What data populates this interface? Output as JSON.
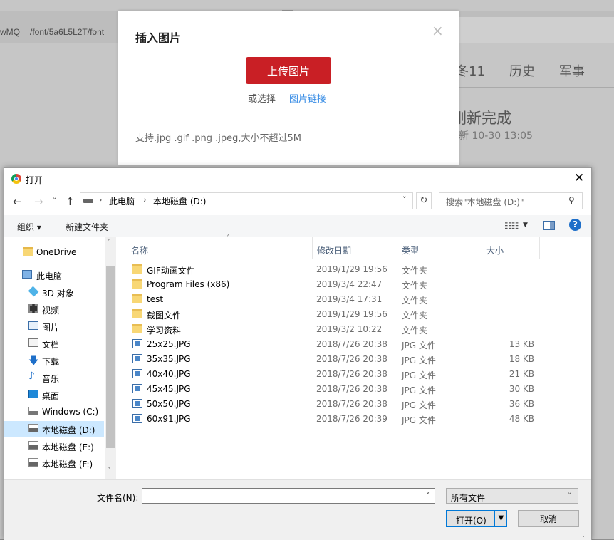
{
  "background": {
    "url_fragment": "wMQ==/font/5a6L5L2T/font",
    "tabs": [
      "冬11",
      "历史",
      "军事"
    ],
    "headline": "刚新完成",
    "meta": "新 10-30 13:05"
  },
  "modal": {
    "title": "插入图片",
    "close": "×",
    "upload_label": "上传图片",
    "or_choose": "或选择",
    "image_link": "图片链接",
    "support_text": "支持.jpg .gif .png .jpeg,大小不超过5M",
    "accent_color": "#c91f25"
  },
  "dialog": {
    "title": "打开",
    "close": "✕",
    "nav": {
      "back": "←",
      "forward": "→",
      "recent": "˅",
      "up": "↑"
    },
    "address": {
      "crumbs": [
        "此电脑",
        "本地磁盘 (D:)"
      ],
      "separator": "›",
      "dropdown": "˅",
      "refresh": "↻"
    },
    "search_placeholder": "搜索\"本地磁盘 (D:)\"",
    "search_icon": "⚲",
    "toolbar": {
      "organize": "组织 ▾",
      "new_folder": "新建文件夹",
      "view_icon": "☷☷",
      "view_drop": "▼",
      "help": "?"
    },
    "tree": [
      {
        "label": "OneDrive",
        "icon": "folder-icon"
      },
      {
        "label": "此电脑",
        "icon": "pc-icon"
      },
      {
        "label": "3D 对象",
        "icon": "3d-objects-icon"
      },
      {
        "label": "视频",
        "icon": "video-icon"
      },
      {
        "label": "图片",
        "icon": "pictures-icon"
      },
      {
        "label": "文档",
        "icon": "documents-icon"
      },
      {
        "label": "下载",
        "icon": "download-icon"
      },
      {
        "label": "音乐",
        "icon": "music-icon"
      },
      {
        "label": "桌面",
        "icon": "desktop-icon"
      },
      {
        "label": "Windows (C:)",
        "icon": "windows-drive-icon"
      },
      {
        "label": "本地磁盘 (D:)",
        "icon": "drive-icon",
        "selected": true
      },
      {
        "label": "本地磁盘 (E:)",
        "icon": "drive-icon"
      },
      {
        "label": "本地磁盘 (F:)",
        "icon": "drive-icon"
      }
    ],
    "scroll": {
      "up": "˄",
      "down": "˅"
    },
    "columns": [
      "名称",
      "修改日期",
      "类型",
      "大小"
    ],
    "sort_caret": "˄",
    "files": [
      {
        "name": "GIF动画文件",
        "date": "2019/1/29 19:56",
        "type": "文件夹",
        "size": "",
        "kind": "folder"
      },
      {
        "name": "Program Files (x86)",
        "date": "2019/3/4 22:47",
        "type": "文件夹",
        "size": "",
        "kind": "folder"
      },
      {
        "name": "test",
        "date": "2019/3/4 17:31",
        "type": "文件夹",
        "size": "",
        "kind": "folder"
      },
      {
        "name": "截图文件",
        "date": "2019/1/29 19:56",
        "type": "文件夹",
        "size": "",
        "kind": "folder"
      },
      {
        "name": "学习资料",
        "date": "2019/3/2 10:22",
        "type": "文件夹",
        "size": "",
        "kind": "folder"
      },
      {
        "name": "25x25.JPG",
        "date": "2018/7/26 20:38",
        "type": "JPG 文件",
        "size": "13 KB",
        "kind": "jpg"
      },
      {
        "name": "35x35.JPG",
        "date": "2018/7/26 20:38",
        "type": "JPG 文件",
        "size": "18 KB",
        "kind": "jpg"
      },
      {
        "name": "40x40.JPG",
        "date": "2018/7/26 20:38",
        "type": "JPG 文件",
        "size": "21 KB",
        "kind": "jpg"
      },
      {
        "name": "45x45.JPG",
        "date": "2018/7/26 20:38",
        "type": "JPG 文件",
        "size": "30 KB",
        "kind": "jpg"
      },
      {
        "name": "50x50.JPG",
        "date": "2018/7/26 20:38",
        "type": "JPG 文件",
        "size": "36 KB",
        "kind": "jpg"
      },
      {
        "name": "60x91.JPG",
        "date": "2018/7/26 20:39",
        "type": "JPG 文件",
        "size": "48 KB",
        "kind": "jpg"
      }
    ],
    "filename_label": "文件名(N):",
    "filename_value": "",
    "filename_drop": "˅",
    "filetype": "所有文件",
    "filetype_drop": "˅",
    "open_label": "打开(O)",
    "open_split": "▼",
    "cancel_label": "取消",
    "grip": "⋰"
  }
}
